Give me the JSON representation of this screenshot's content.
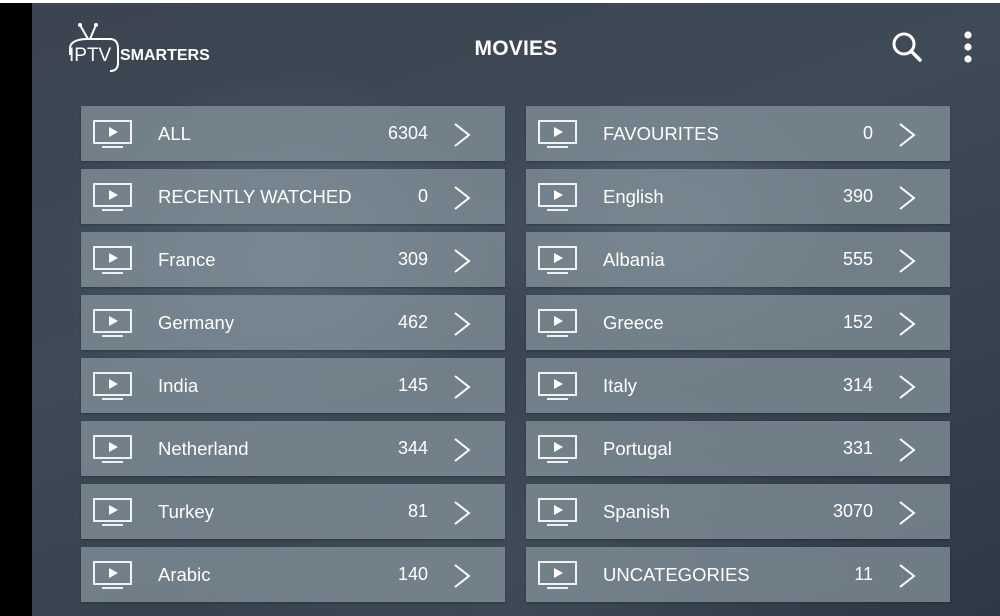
{
  "app": {
    "logo_text_left": "IPTV",
    "logo_text_right": "SMARTERS",
    "title": "MOVIES",
    "icons": {
      "search": "search-icon",
      "more": "more-vertical-icon",
      "category": "tv-play-icon",
      "chevron": "chevron-right-icon"
    }
  },
  "categories": {
    "left": [
      {
        "label": "ALL",
        "count": "6304"
      },
      {
        "label": "RECENTLY WATCHED",
        "count": "0"
      },
      {
        "label": "France",
        "count": "309"
      },
      {
        "label": "Germany",
        "count": "462"
      },
      {
        "label": "India",
        "count": "145"
      },
      {
        "label": "Netherland",
        "count": "344"
      },
      {
        "label": "Turkey",
        "count": "81"
      },
      {
        "label": "Arabic",
        "count": "140"
      }
    ],
    "right": [
      {
        "label": "FAVOURITES",
        "count": "0"
      },
      {
        "label": "English",
        "count": "390"
      },
      {
        "label": "Albania",
        "count": "555"
      },
      {
        "label": "Greece",
        "count": "152"
      },
      {
        "label": "Italy",
        "count": "314"
      },
      {
        "label": "Portugal",
        "count": "331"
      },
      {
        "label": "Spanish",
        "count": "3070"
      },
      {
        "label": "UNCATEGORIES",
        "count": "11"
      }
    ]
  }
}
